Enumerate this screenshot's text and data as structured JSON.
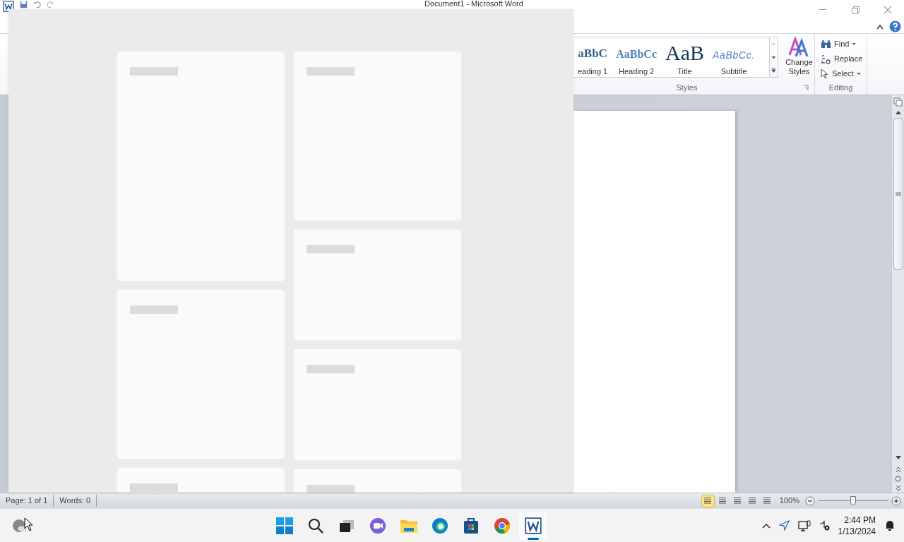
{
  "window": {
    "title": "Document1 - Microsoft Word"
  },
  "ribbon": {
    "styles": [
      {
        "preview": "aBbC",
        "label": "eading 1",
        "kind": "heading1"
      },
      {
        "preview": "AaBbCc",
        "label": "Heading 2",
        "kind": "heading2"
      },
      {
        "preview": "AaB",
        "label": "Title",
        "kind": "title"
      },
      {
        "preview": "AaBbCc.",
        "label": "Subtitle",
        "kind": "subtitle"
      }
    ],
    "styles_group": "Styles",
    "change_styles": "Change Styles",
    "editing": [
      {
        "label": "Find",
        "kind": "find"
      },
      {
        "label": "Replace",
        "kind": "replace"
      },
      {
        "label": "Select",
        "kind": "select"
      }
    ],
    "editing_group": "Editing"
  },
  "status_bar": {
    "page": "Page: 1 of 1",
    "words": "Words: 0",
    "views": [
      {
        "selected": true
      },
      {
        "selected": false
      },
      {
        "selected": false
      },
      {
        "selected": false
      },
      {
        "selected": false
      }
    ],
    "zoom": "100%",
    "level": 0.5
  },
  "taskbar": {
    "apps": [
      {
        "kind": "start",
        "selected": false
      },
      {
        "kind": "search",
        "selected": false
      },
      {
        "kind": "taskview",
        "selected": false
      },
      {
        "kind": "chat",
        "selected": false
      },
      {
        "kind": "files",
        "selected": false
      },
      {
        "kind": "edge",
        "selected": false
      },
      {
        "kind": "store",
        "selected": false
      },
      {
        "kind": "chrome",
        "selected": false
      },
      {
        "kind": "word",
        "selected": true
      }
    ],
    "time": "2:44 PM",
    "date": "1/13/2024"
  }
}
